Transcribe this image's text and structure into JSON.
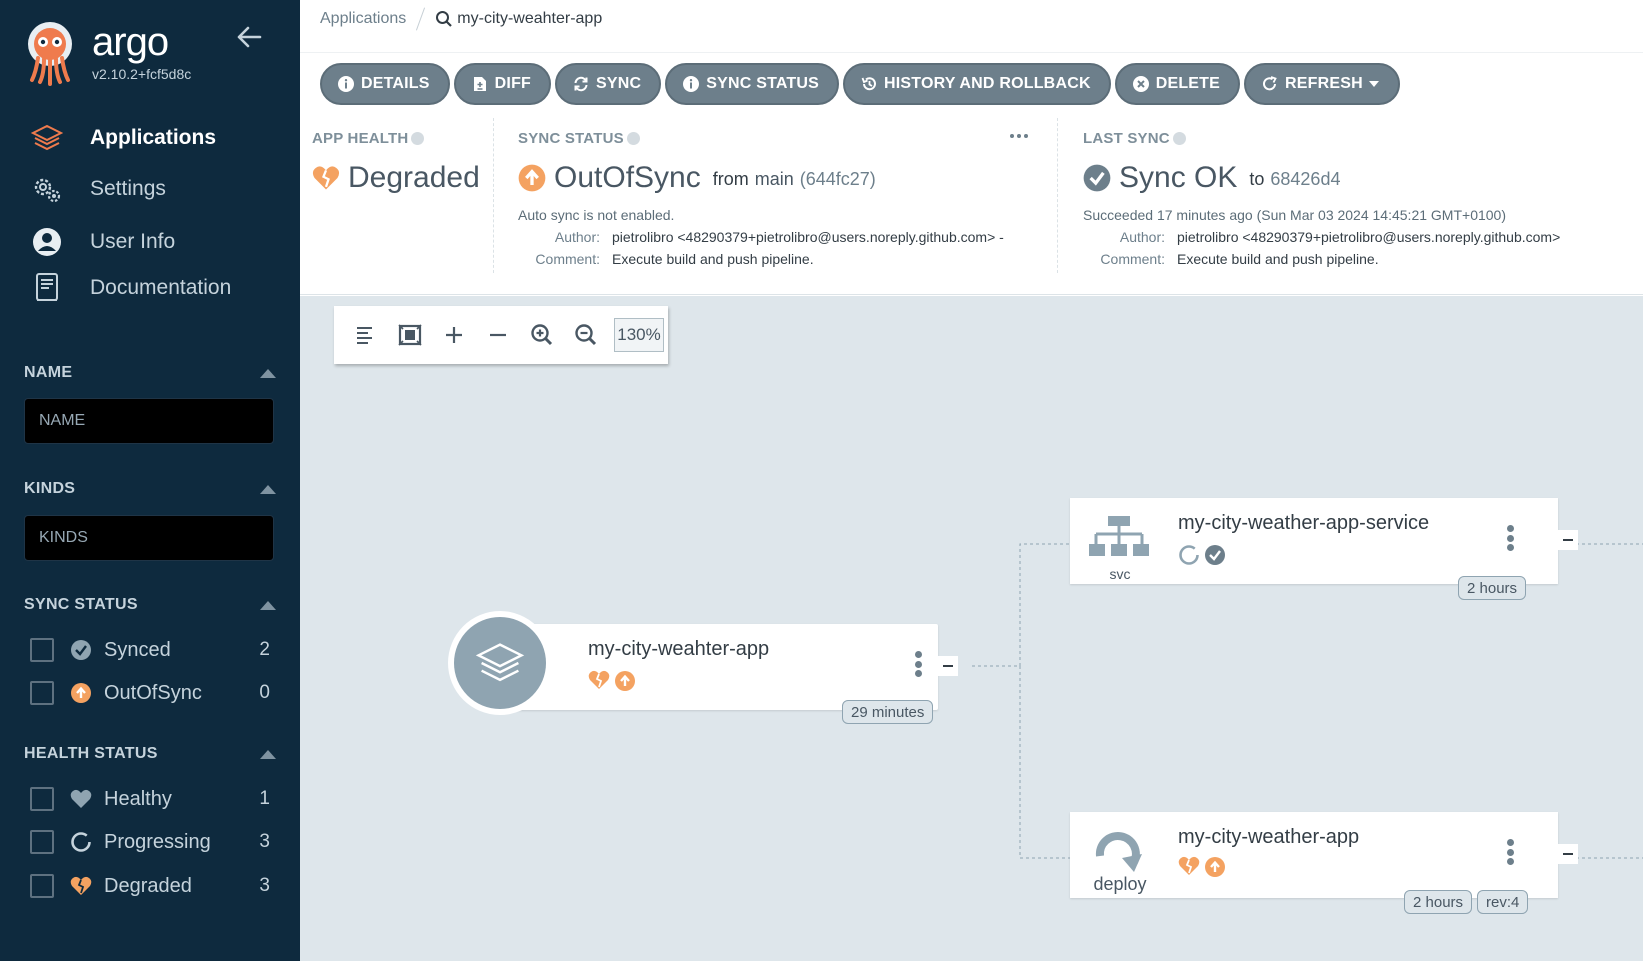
{
  "sidebar": {
    "brand": "argo",
    "version": "v2.10.2+fcf5d8c",
    "nav": [
      {
        "label": "Applications",
        "icon": "layers-icon"
      },
      {
        "label": "Settings",
        "icon": "gears-icon"
      },
      {
        "label": "User Info",
        "icon": "user-circle-icon"
      },
      {
        "label": "Documentation",
        "icon": "book-icon"
      }
    ],
    "filters": {
      "name": {
        "title": "NAME",
        "placeholder": "NAME"
      },
      "kinds": {
        "title": "KINDS",
        "placeholder": "KINDS"
      },
      "sync_status": {
        "title": "SYNC STATUS",
        "items": [
          {
            "label": "Synced",
            "count": "2",
            "icon": "check-circle-icon"
          },
          {
            "label": "OutOfSync",
            "count": "0",
            "icon": "arrow-up-circle-icon"
          }
        ]
      },
      "health_status": {
        "title": "HEALTH STATUS",
        "items": [
          {
            "label": "Healthy",
            "count": "1",
            "icon": "heart-icon"
          },
          {
            "label": "Progressing",
            "count": "3",
            "icon": "circle-notch-icon"
          },
          {
            "label": "Degraded",
            "count": "3",
            "icon": "heart-broken-icon"
          }
        ]
      }
    }
  },
  "breadcrumb": {
    "root": "Applications",
    "current": "my-city-weahter-app"
  },
  "toolbar": {
    "details": "DETAILS",
    "diff": "DIFF",
    "sync": "SYNC",
    "sync_status": "SYNC STATUS",
    "history": "HISTORY AND ROLLBACK",
    "delete": "DELETE",
    "refresh": "REFRESH"
  },
  "status": {
    "app_health": {
      "label": "APP HEALTH",
      "value": "Degraded"
    },
    "sync_status": {
      "label": "SYNC STATUS",
      "value": "OutOfSync",
      "from": "from",
      "branch": "main",
      "revision": "(644fc27)",
      "note": "Auto sync is not enabled.",
      "author_key": "Author:",
      "author": "pietrolibro <48290379+pietrolibro@users.noreply.github.com> -",
      "comment_key": "Comment:",
      "comment": "Execute build and push pipeline."
    },
    "last_sync": {
      "label": "LAST SYNC",
      "value": "Sync OK",
      "to": "to",
      "revision": "68426d4",
      "note": "Succeeded 17 minutes ago (Sun Mar 03 2024 14:45:21 GMT+0100)",
      "author_key": "Author:",
      "author": "pietrolibro <48290379+pietrolibro@users.noreply.github.com>",
      "comment_key": "Comment:",
      "comment": "Execute build and push pipeline."
    }
  },
  "graph": {
    "zoom": "130%",
    "app_node": {
      "name": "my-city-weahter-app",
      "age": "29 minutes"
    },
    "service_node": {
      "name": "my-city-weather-app-service",
      "kind": "svc",
      "age": "2 hours"
    },
    "deploy_node": {
      "name": "my-city-weather-app",
      "kind": "deploy",
      "age": "2 hours",
      "rev": "rev:4"
    }
  },
  "colors": {
    "sidebar_bg": "#0e2a3e",
    "button_bg": "#6d7f8b",
    "degraded": "#f4a261",
    "out_of_sync": "#f4a261",
    "synced": "#18be94",
    "graph_bg": "#dee6eb"
  }
}
